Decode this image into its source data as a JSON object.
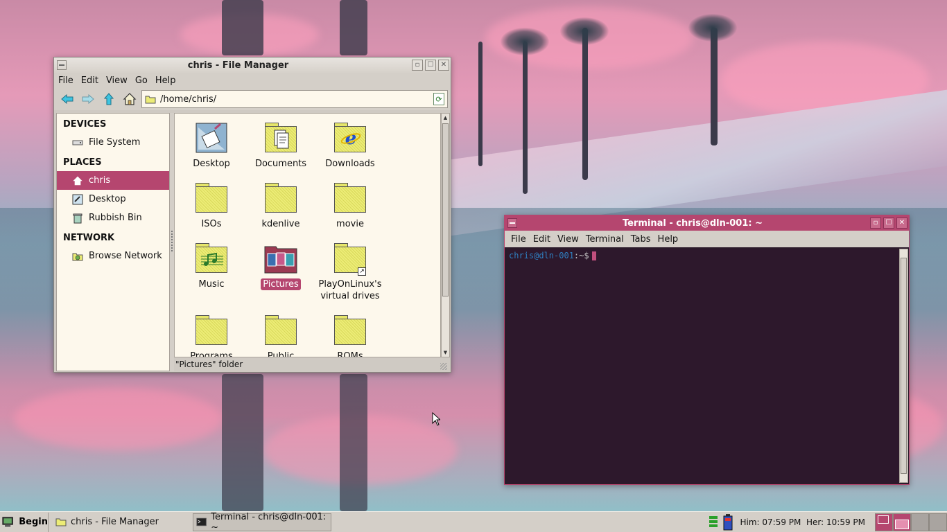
{
  "file_manager": {
    "title": "chris - File Manager",
    "menu": [
      "File",
      "Edit",
      "View",
      "Go",
      "Help"
    ],
    "path": "/home/chris/",
    "sidebar": {
      "devices_heading": "DEVICES",
      "devices": [
        {
          "label": "File System",
          "icon": "drive-icon"
        }
      ],
      "places_heading": "PLACES",
      "places": [
        {
          "label": "chris",
          "icon": "home-icon",
          "selected": true
        },
        {
          "label": "Desktop",
          "icon": "desktop-icon"
        },
        {
          "label": "Rubbish Bin",
          "icon": "trash-icon"
        }
      ],
      "network_heading": "NETWORK",
      "network": [
        {
          "label": "Browse Network",
          "icon": "network-icon"
        }
      ]
    },
    "files": [
      {
        "label": "Desktop",
        "icon": "desktop-folder-icon"
      },
      {
        "label": "Documents",
        "icon": "documents-folder-icon"
      },
      {
        "label": "Downloads",
        "icon": "downloads-folder-icon"
      },
      {
        "label": "ISOs",
        "icon": "folder-icon"
      },
      {
        "label": "kdenlive",
        "icon": "folder-icon"
      },
      {
        "label": "movie",
        "icon": "folder-icon"
      },
      {
        "label": "Music",
        "icon": "music-folder-icon"
      },
      {
        "label": "Pictures",
        "icon": "pictures-folder-icon",
        "selected": true
      },
      {
        "label": "PlayOnLinux's virtual drives",
        "icon": "folder-link-icon"
      },
      {
        "label": "Programs",
        "icon": "folder-icon"
      },
      {
        "label": "Public",
        "icon": "public-folder-icon"
      },
      {
        "label": "ROMs",
        "icon": "folder-icon"
      }
    ],
    "status": "\"Pictures\" folder"
  },
  "terminal": {
    "title": "Terminal - chris@dln-001: ~",
    "menu": [
      "File",
      "Edit",
      "View",
      "Terminal",
      "Tabs",
      "Help"
    ],
    "prompt_user": "chris@dln-001",
    "prompt_sym": ":~$"
  },
  "taskbar": {
    "start_label": "Begin",
    "tasks": [
      {
        "label": "chris - File Manager",
        "icon": "folder-icon"
      },
      {
        "label": "Terminal - chris@dln-001: ~",
        "icon": "terminal-icon",
        "active": true
      }
    ],
    "clock": "Him: 07:59 PM  Her: 10:59 PM"
  },
  "colors": {
    "accent": "#b5466f",
    "panel": "#d4cfc8",
    "view_bg": "#fdf8ec"
  }
}
